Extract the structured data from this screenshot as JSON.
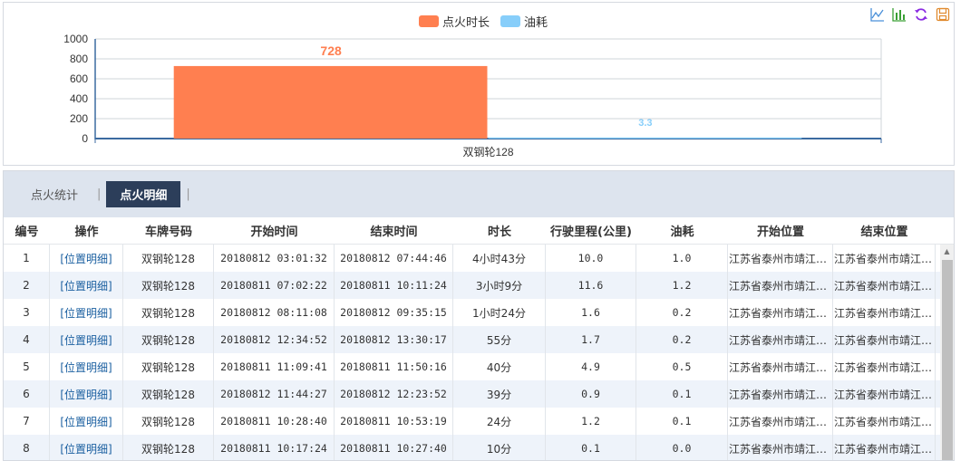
{
  "chart_data": {
    "type": "bar",
    "categories": [
      "双钢轮128"
    ],
    "series": [
      {
        "name": "点火时长",
        "values": [
          728
        ],
        "color": "#ff7f50"
      },
      {
        "name": "油耗",
        "values": [
          3.3
        ],
        "color": "#87cefa"
      }
    ],
    "ylim": [
      0,
      1000
    ],
    "yticks": [
      0,
      200,
      400,
      600,
      800,
      1000
    ],
    "grid": true,
    "legend": "top-center",
    "data_labels": [
      "728",
      "3.3"
    ]
  },
  "toolbox": {
    "line_icon": "line-chart-icon",
    "bar_icon": "bar-chart-icon",
    "restore_icon": "refresh-icon",
    "save_icon": "save-icon"
  },
  "tabs": [
    {
      "label": "点火统计",
      "active": false
    },
    {
      "label": "点火明细",
      "active": true
    }
  ],
  "table": {
    "columns": [
      "编号",
      "操作",
      "车牌号码",
      "开始时间",
      "结束时间",
      "时长",
      "行驶里程(公里)",
      "油耗",
      "开始位置",
      "结束位置"
    ],
    "rows": [
      [
        "1",
        "[位置明细]",
        "双钢轮128",
        "20180812 03:01:32",
        "20180812 07:44:46",
        "4小时43分",
        "10.0",
        "1.0",
        "江苏省泰州市靖江…",
        "江苏省泰州市靖江…"
      ],
      [
        "2",
        "[位置明细]",
        "双钢轮128",
        "20180811 07:02:22",
        "20180811 10:11:24",
        "3小时9分",
        "11.6",
        "1.2",
        "江苏省泰州市靖江…",
        "江苏省泰州市靖江…"
      ],
      [
        "3",
        "[位置明细]",
        "双钢轮128",
        "20180812 08:11:08",
        "20180812 09:35:15",
        "1小时24分",
        "1.6",
        "0.2",
        "江苏省泰州市靖江…",
        "江苏省泰州市靖江…"
      ],
      [
        "4",
        "[位置明细]",
        "双钢轮128",
        "20180812 12:34:52",
        "20180812 13:30:17",
        "55分",
        "1.7",
        "0.2",
        "江苏省泰州市靖江…",
        "江苏省泰州市靖江…"
      ],
      [
        "5",
        "[位置明细]",
        "双钢轮128",
        "20180811 11:09:41",
        "20180811 11:50:16",
        "40分",
        "4.9",
        "0.5",
        "江苏省泰州市靖江…",
        "江苏省泰州市靖江…"
      ],
      [
        "6",
        "[位置明细]",
        "双钢轮128",
        "20180812 11:44:27",
        "20180812 12:23:52",
        "39分",
        "0.9",
        "0.1",
        "江苏省泰州市靖江…",
        "江苏省泰州市靖江…"
      ],
      [
        "7",
        "[位置明细]",
        "双钢轮128",
        "20180811 10:28:40",
        "20180811 10:53:19",
        "24分",
        "1.2",
        "0.1",
        "江苏省泰州市靖江…",
        "江苏省泰州市靖江…"
      ],
      [
        "8",
        "[位置明细]",
        "双钢轮128",
        "20180811 10:17:24",
        "20180811 10:27:40",
        "10分",
        "0.1",
        "0.0",
        "江苏省泰州市靖江…",
        "江苏省泰州市靖江…"
      ]
    ]
  }
}
